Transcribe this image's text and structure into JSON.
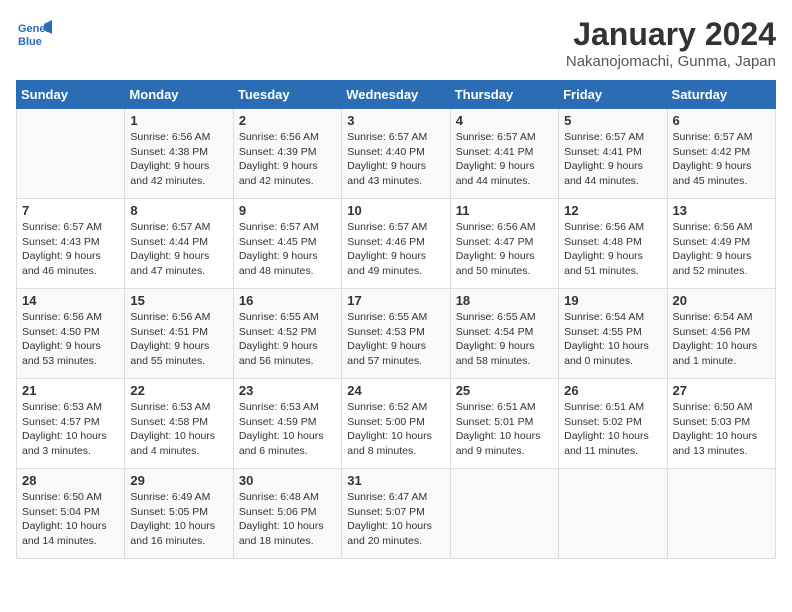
{
  "header": {
    "logo_line1": "General",
    "logo_line2": "Blue",
    "month_title": "January 2024",
    "location": "Nakanojomachi, Gunma, Japan"
  },
  "weekdays": [
    "Sunday",
    "Monday",
    "Tuesday",
    "Wednesday",
    "Thursday",
    "Friday",
    "Saturday"
  ],
  "weeks": [
    [
      {
        "day": "",
        "info": ""
      },
      {
        "day": "1",
        "info": "Sunrise: 6:56 AM\nSunset: 4:38 PM\nDaylight: 9 hours\nand 42 minutes."
      },
      {
        "day": "2",
        "info": "Sunrise: 6:56 AM\nSunset: 4:39 PM\nDaylight: 9 hours\nand 42 minutes."
      },
      {
        "day": "3",
        "info": "Sunrise: 6:57 AM\nSunset: 4:40 PM\nDaylight: 9 hours\nand 43 minutes."
      },
      {
        "day": "4",
        "info": "Sunrise: 6:57 AM\nSunset: 4:41 PM\nDaylight: 9 hours\nand 44 minutes."
      },
      {
        "day": "5",
        "info": "Sunrise: 6:57 AM\nSunset: 4:41 PM\nDaylight: 9 hours\nand 44 minutes."
      },
      {
        "day": "6",
        "info": "Sunrise: 6:57 AM\nSunset: 4:42 PM\nDaylight: 9 hours\nand 45 minutes."
      }
    ],
    [
      {
        "day": "7",
        "info": "Sunrise: 6:57 AM\nSunset: 4:43 PM\nDaylight: 9 hours\nand 46 minutes."
      },
      {
        "day": "8",
        "info": "Sunrise: 6:57 AM\nSunset: 4:44 PM\nDaylight: 9 hours\nand 47 minutes."
      },
      {
        "day": "9",
        "info": "Sunrise: 6:57 AM\nSunset: 4:45 PM\nDaylight: 9 hours\nand 48 minutes."
      },
      {
        "day": "10",
        "info": "Sunrise: 6:57 AM\nSunset: 4:46 PM\nDaylight: 9 hours\nand 49 minutes."
      },
      {
        "day": "11",
        "info": "Sunrise: 6:56 AM\nSunset: 4:47 PM\nDaylight: 9 hours\nand 50 minutes."
      },
      {
        "day": "12",
        "info": "Sunrise: 6:56 AM\nSunset: 4:48 PM\nDaylight: 9 hours\nand 51 minutes."
      },
      {
        "day": "13",
        "info": "Sunrise: 6:56 AM\nSunset: 4:49 PM\nDaylight: 9 hours\nand 52 minutes."
      }
    ],
    [
      {
        "day": "14",
        "info": "Sunrise: 6:56 AM\nSunset: 4:50 PM\nDaylight: 9 hours\nand 53 minutes."
      },
      {
        "day": "15",
        "info": "Sunrise: 6:56 AM\nSunset: 4:51 PM\nDaylight: 9 hours\nand 55 minutes."
      },
      {
        "day": "16",
        "info": "Sunrise: 6:55 AM\nSunset: 4:52 PM\nDaylight: 9 hours\nand 56 minutes."
      },
      {
        "day": "17",
        "info": "Sunrise: 6:55 AM\nSunset: 4:53 PM\nDaylight: 9 hours\nand 57 minutes."
      },
      {
        "day": "18",
        "info": "Sunrise: 6:55 AM\nSunset: 4:54 PM\nDaylight: 9 hours\nand 58 minutes."
      },
      {
        "day": "19",
        "info": "Sunrise: 6:54 AM\nSunset: 4:55 PM\nDaylight: 10 hours\nand 0 minutes."
      },
      {
        "day": "20",
        "info": "Sunrise: 6:54 AM\nSunset: 4:56 PM\nDaylight: 10 hours\nand 1 minute."
      }
    ],
    [
      {
        "day": "21",
        "info": "Sunrise: 6:53 AM\nSunset: 4:57 PM\nDaylight: 10 hours\nand 3 minutes."
      },
      {
        "day": "22",
        "info": "Sunrise: 6:53 AM\nSunset: 4:58 PM\nDaylight: 10 hours\nand 4 minutes."
      },
      {
        "day": "23",
        "info": "Sunrise: 6:53 AM\nSunset: 4:59 PM\nDaylight: 10 hours\nand 6 minutes."
      },
      {
        "day": "24",
        "info": "Sunrise: 6:52 AM\nSunset: 5:00 PM\nDaylight: 10 hours\nand 8 minutes."
      },
      {
        "day": "25",
        "info": "Sunrise: 6:51 AM\nSunset: 5:01 PM\nDaylight: 10 hours\nand 9 minutes."
      },
      {
        "day": "26",
        "info": "Sunrise: 6:51 AM\nSunset: 5:02 PM\nDaylight: 10 hours\nand 11 minutes."
      },
      {
        "day": "27",
        "info": "Sunrise: 6:50 AM\nSunset: 5:03 PM\nDaylight: 10 hours\nand 13 minutes."
      }
    ],
    [
      {
        "day": "28",
        "info": "Sunrise: 6:50 AM\nSunset: 5:04 PM\nDaylight: 10 hours\nand 14 minutes."
      },
      {
        "day": "29",
        "info": "Sunrise: 6:49 AM\nSunset: 5:05 PM\nDaylight: 10 hours\nand 16 minutes."
      },
      {
        "day": "30",
        "info": "Sunrise: 6:48 AM\nSunset: 5:06 PM\nDaylight: 10 hours\nand 18 minutes."
      },
      {
        "day": "31",
        "info": "Sunrise: 6:47 AM\nSunset: 5:07 PM\nDaylight: 10 hours\nand 20 minutes."
      },
      {
        "day": "",
        "info": ""
      },
      {
        "day": "",
        "info": ""
      },
      {
        "day": "",
        "info": ""
      }
    ]
  ]
}
